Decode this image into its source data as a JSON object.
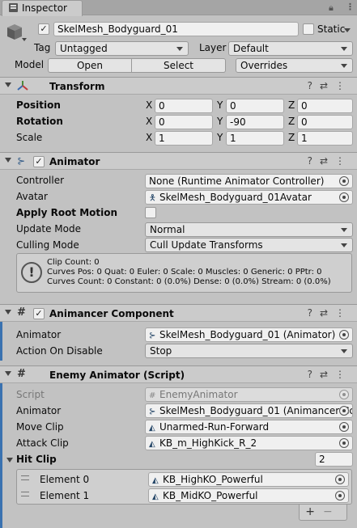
{
  "window": {
    "tab_label": "Inspector",
    "lock_icon": "lock-icon",
    "menu_icon": "kebab-menu-icon"
  },
  "object": {
    "active": true,
    "name": "SkelMesh_Bodyguard_01",
    "static_label": "Static",
    "static_checked": false,
    "tag_label": "Tag",
    "tag_value": "Untagged",
    "layer_label": "Layer",
    "layer_value": "Default",
    "model_label": "Model",
    "open_label": "Open",
    "select_label": "Select",
    "overrides_value": "Overrides"
  },
  "transform": {
    "title": "Transform",
    "rows": [
      {
        "label": "Position",
        "x": "0",
        "y": "0",
        "z": "0"
      },
      {
        "label": "Rotation",
        "x": "0",
        "y": "-90",
        "z": "0"
      },
      {
        "label": "Scale",
        "x": "1",
        "y": "1",
        "z": "1"
      }
    ],
    "axis_x": "X",
    "axis_y": "Y",
    "axis_z": "Z"
  },
  "animator": {
    "title": "Animator",
    "enabled": true,
    "controller_label": "Controller",
    "controller_value": "None (Runtime Animator Controller)",
    "avatar_label": "Avatar",
    "avatar_value": "SkelMesh_Bodyguard_01Avatar",
    "apply_root_motion_label": "Apply Root Motion",
    "apply_root_motion": false,
    "update_mode_label": "Update Mode",
    "update_mode_value": "Normal",
    "culling_mode_label": "Culling Mode",
    "culling_mode_value": "Cull Update Transforms",
    "info_lines": [
      "Clip Count: 0",
      "Curves Pos: 0 Quat: 0 Euler: 0 Scale: 0 Muscles: 0 Generic: 0 PPtr: 0",
      "Curves Count: 0 Constant: 0 (0.0%) Dense: 0 (0.0%) Stream: 0 (0.0%)"
    ]
  },
  "animancer": {
    "title": "Animancer Component",
    "enabled": true,
    "animator_label": "Animator",
    "animator_value": "SkelMesh_Bodyguard_01 (Animator)",
    "action_label": "Action On Disable",
    "action_value": "Stop"
  },
  "enemy": {
    "title": "Enemy Animator (Script)",
    "script_label": "Script",
    "script_value": "EnemyAnimator",
    "animator_label": "Animator",
    "animator_value": "SkelMesh_Bodyguard_01 (Animancer Cc",
    "move_clip_label": "Move Clip",
    "move_clip_value": "Unarmed-Run-Forward",
    "attack_clip_label": "Attack Clip",
    "attack_clip_value": "KB_m_HighKick_R_2",
    "hit_clip_label": "Hit Clip",
    "hit_clip_count": "2",
    "elements": [
      {
        "label": "Element 0",
        "value": "KB_HighKO_Powerful"
      },
      {
        "label": "Element 1",
        "value": "KB_MidKO_Powerful"
      }
    ],
    "add_label": "+",
    "remove_label": "−"
  }
}
